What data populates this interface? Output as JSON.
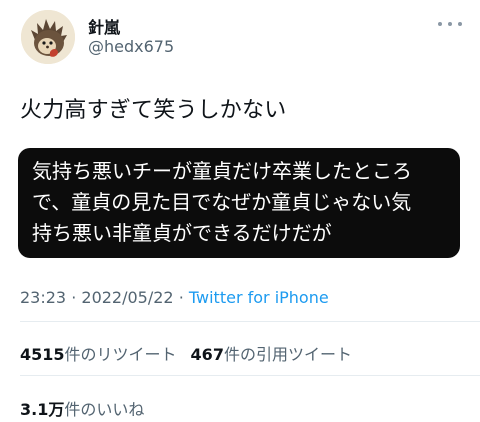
{
  "author": {
    "display_name": "針嵐",
    "handle": "@hedx675",
    "avatar_icon": "hedgehog-avatar"
  },
  "tweet": {
    "text": "火力高すぎて笑うしかない",
    "quote_lines": [
      "気持ち悪いチーが童貞だけ卒業したところ",
      "で、童貞の見た目でなぜか童貞じゃない気",
      "持ち悪い非童貞ができるだけだが"
    ]
  },
  "meta": {
    "time": "23:23",
    "separator": "·",
    "date": "2022/05/22",
    "source": "Twitter for iPhone"
  },
  "stats": {
    "retweets_count": "4515",
    "retweets_label": "件のリツイート",
    "quotes_count": "467",
    "quotes_label": "件の引用ツイート",
    "likes_count": "3.1万",
    "likes_label": "件のいいね"
  },
  "colors": {
    "text": "#0f1419",
    "secondary": "#536471",
    "link": "#1d9bf0",
    "card": "#0c0c0c"
  }
}
